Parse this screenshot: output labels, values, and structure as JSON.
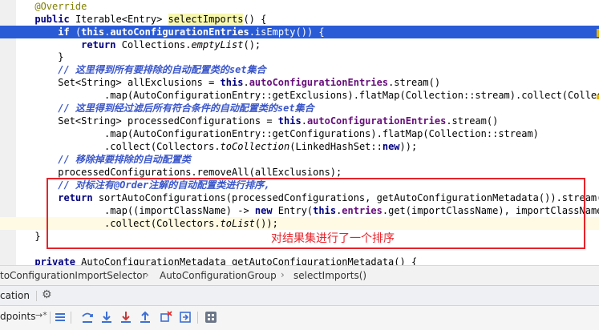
{
  "editor": {
    "lines": [
      {
        "parts": [
          {
            "t": "    "
          },
          {
            "t": "@Override",
            "c": "ann"
          }
        ]
      },
      {
        "parts": [
          {
            "t": "    "
          },
          {
            "t": "public ",
            "c": "kw"
          },
          {
            "t": "Iterable<Entry> "
          },
          {
            "t": "selectImports",
            "c": "mhl"
          },
          {
            "t": "() {"
          }
        ]
      },
      {
        "hl": true,
        "parts": [
          {
            "t": "        "
          },
          {
            "t": "if ",
            "c": "kw"
          },
          {
            "t": "("
          },
          {
            "t": "this",
            "c": "kw"
          },
          {
            "t": "."
          },
          {
            "t": "autoConfigurationEntries",
            "c": "fld"
          },
          {
            "t": ".isEmpty()) {"
          }
        ]
      },
      {
        "parts": [
          {
            "t": "            "
          },
          {
            "t": "return ",
            "c": "kw"
          },
          {
            "t": "Collections."
          },
          {
            "t": "emptyList",
            "c": "it"
          },
          {
            "t": "();"
          }
        ]
      },
      {
        "parts": [
          {
            "t": "        }"
          }
        ]
      },
      {
        "parts": [
          {
            "t": "        "
          },
          {
            "t": "// 这里得到所有要排除的自动配置类的set集合",
            "c": "cm"
          }
        ]
      },
      {
        "parts": [
          {
            "t": "        Set<String> allExclusions = "
          },
          {
            "t": "this",
            "c": "kw"
          },
          {
            "t": "."
          },
          {
            "t": "autoConfigurationEntries",
            "c": "fld"
          },
          {
            "t": ".stream()"
          }
        ]
      },
      {
        "parts": [
          {
            "t": "                .map(AutoConfigurationEntry::getExclusions).flatMap(Collection::stream).collect(Collectors."
          }
        ]
      },
      {
        "parts": [
          {
            "t": "        "
          },
          {
            "t": "// 这里得到经过滤后所有符合条件的自动配置类的set集合",
            "c": "cm"
          }
        ]
      },
      {
        "parts": [
          {
            "t": "        Set<String> processedConfigurations = "
          },
          {
            "t": "this",
            "c": "kw"
          },
          {
            "t": "."
          },
          {
            "t": "autoConfigurationEntries",
            "c": "fld"
          },
          {
            "t": ".stream()"
          }
        ]
      },
      {
        "parts": [
          {
            "t": "                .map(AutoConfigurationEntry::getConfigurations).flatMap(Collection::stream)"
          }
        ]
      },
      {
        "parts": [
          {
            "t": "                .collect(Collectors."
          },
          {
            "t": "toCollection",
            "c": "it"
          },
          {
            "t": "(LinkedHashSet::"
          },
          {
            "t": "new",
            "c": "kw"
          },
          {
            "t": "));"
          }
        ]
      },
      {
        "parts": [
          {
            "t": "        "
          },
          {
            "t": "// 移除掉要排除的自动配置类",
            "c": "cm"
          }
        ]
      },
      {
        "parts": [
          {
            "t": "        processedConfigurations.removeAll(allExclusions);"
          }
        ]
      },
      {
        "parts": [
          {
            "t": "        "
          },
          {
            "t": "// 对标注有@Order注解的自动配置类进行排序,",
            "c": "cm"
          }
        ]
      },
      {
        "parts": [
          {
            "t": "        "
          },
          {
            "t": "return ",
            "c": "kw"
          },
          {
            "t": "sortAutoConfigurations(processedConfigurations, getAutoConfigurationMetadata()).stream()"
          }
        ]
      },
      {
        "parts": [
          {
            "t": "                .map((importClassName) -> "
          },
          {
            "t": "new ",
            "c": "kw"
          },
          {
            "t": "Entry("
          },
          {
            "t": "this",
            "c": "kw"
          },
          {
            "t": "."
          },
          {
            "t": "entries",
            "c": "fld"
          },
          {
            "t": ".get(importClassName), importClassName))"
          }
        ]
      },
      {
        "cur": true,
        "parts": [
          {
            "t": "                .collect(Collectors."
          },
          {
            "t": "toList",
            "c": "it"
          },
          {
            "t": "());"
          }
        ]
      },
      {
        "parts": [
          {
            "t": "    }"
          }
        ]
      },
      {
        "parts": [
          {
            "t": ""
          }
        ]
      },
      {
        "parts": [
          {
            "t": "    "
          },
          {
            "t": "private ",
            "c": "kw"
          },
          {
            "t": "AutoConfigurationMetadata getAutoConfigurationMetadata() {"
          }
        ]
      }
    ],
    "annotation_text": "对结果集进行了一个排序"
  },
  "breadcrumb": {
    "items": [
      "toConfigurationImportSelector",
      "AutoConfigurationGroup",
      "selectImports()"
    ],
    "separator": "›"
  },
  "debug_panel": {
    "title": "cation",
    "breakpoints_tab": "dpoints",
    "pin_label": "→*"
  },
  "toolbar_icons": [
    "menu-lines-icon",
    "step-over-icon",
    "step-into-icon",
    "force-step-into-icon",
    "step-out-icon",
    "drop-frame-icon",
    "run-to-cursor-icon",
    "evaluate-icon"
  ],
  "colors": {
    "annotation_box": "#e8232a",
    "selection_line": "#2a5bd6",
    "comment": "#3a56c9",
    "keyword": "#000080",
    "field": "#660e7a"
  }
}
